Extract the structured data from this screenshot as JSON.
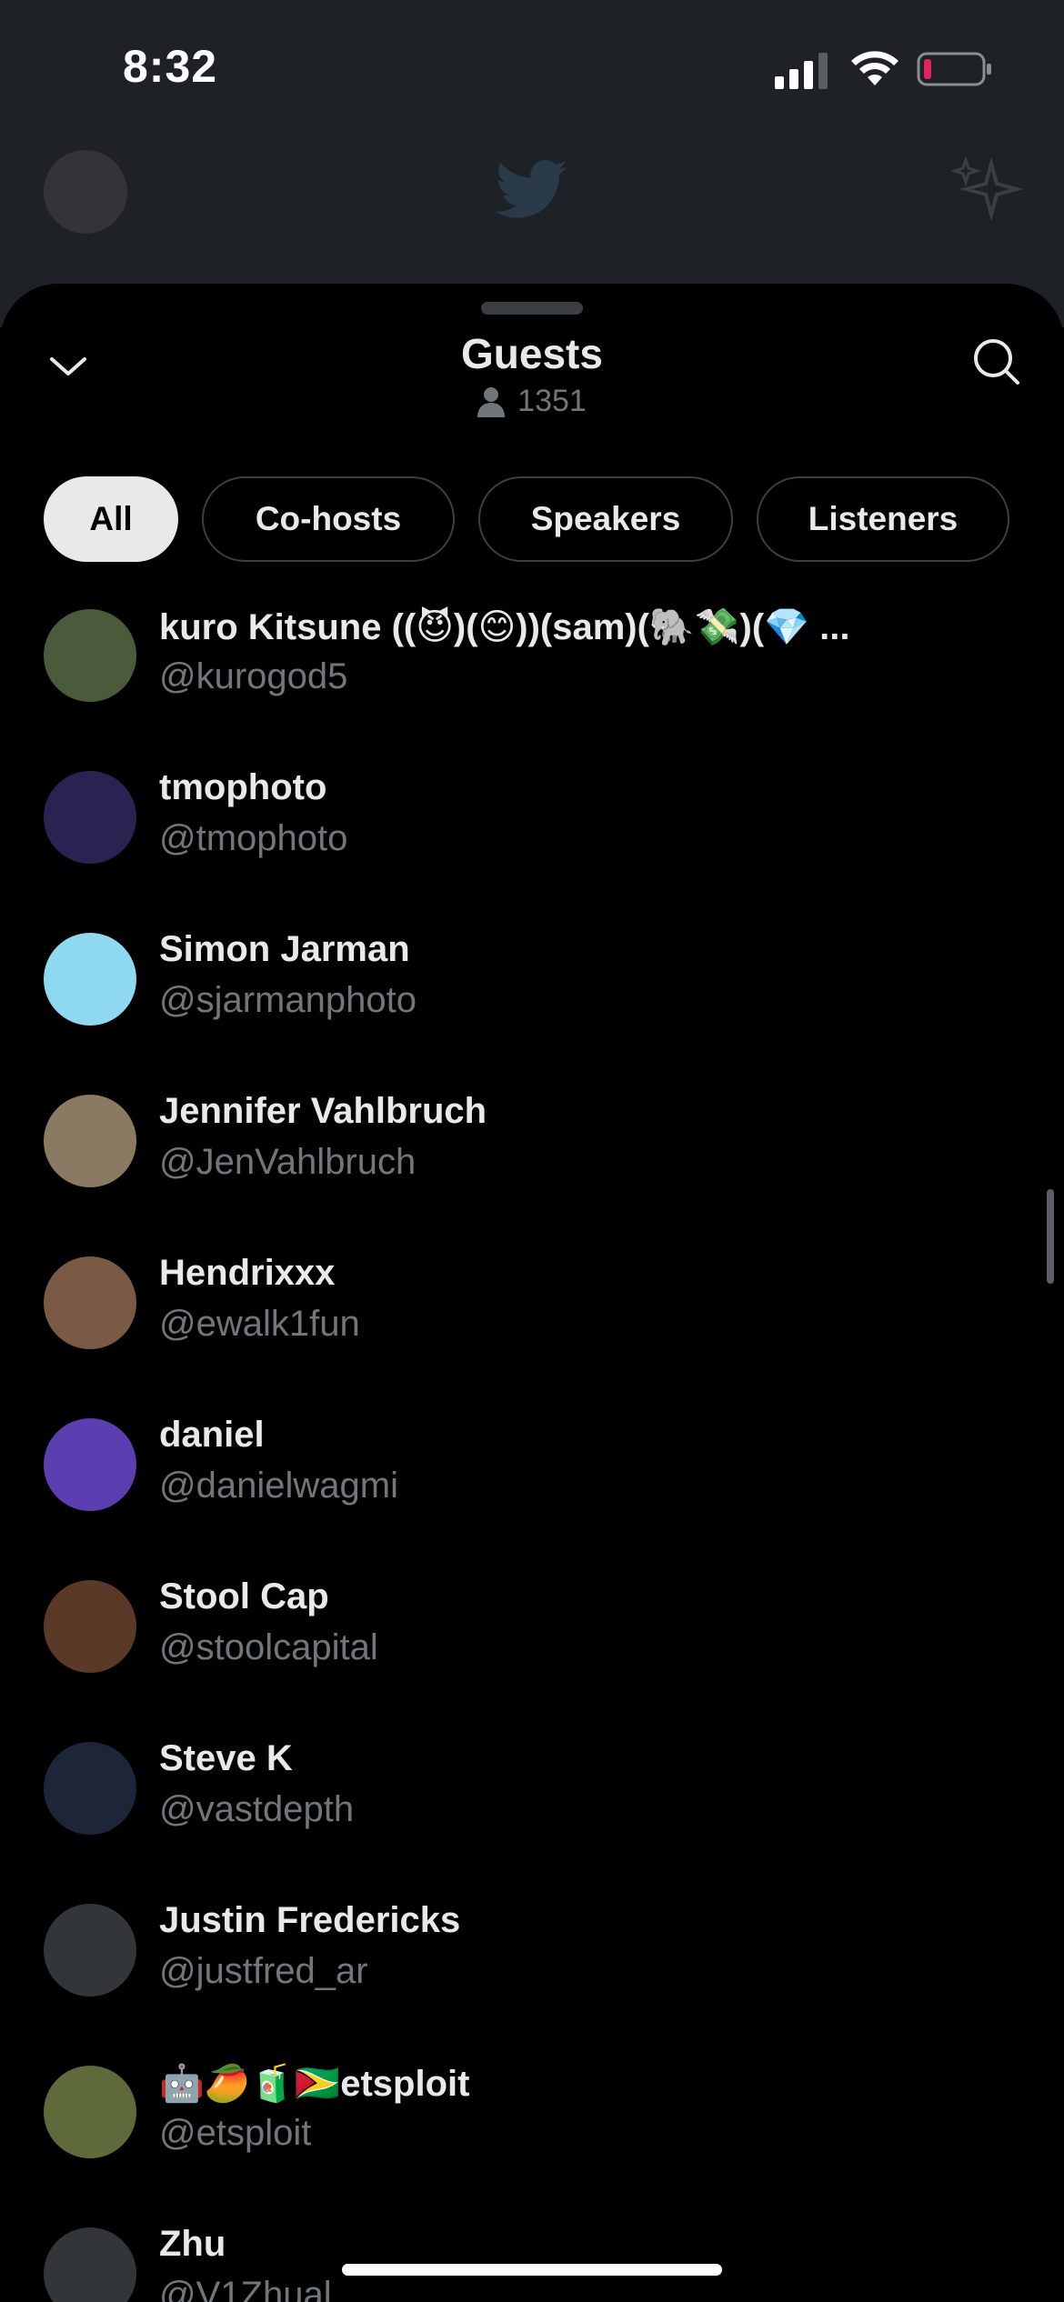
{
  "status": {
    "time": "8:32"
  },
  "sheet": {
    "title": "Guests",
    "listener_count": "1351"
  },
  "tabs": [
    {
      "label": "All",
      "active": true
    },
    {
      "label": "Co-hosts",
      "active": false
    },
    {
      "label": "Speakers",
      "active": false
    },
    {
      "label": "Listeners",
      "active": false
    }
  ],
  "guests": [
    {
      "name": "kuro Kitsune ((😈)(😊))(sam)(🐘💸)(💎 ...",
      "handle": "@kurogod5",
      "avatar_color": "#4a5a3a"
    },
    {
      "name": "tmophoto",
      "handle": "@tmophoto",
      "avatar_color": "#2a2352"
    },
    {
      "name": "Simon Jarman",
      "handle": "@sjarmanphoto",
      "avatar_color": "#8ed8f0"
    },
    {
      "name": "Jennifer Vahlbruch",
      "handle": "@JenVahlbruch",
      "avatar_color": "#8a7a62"
    },
    {
      "name": "Hendrixxx",
      "handle": "@ewalk1fun",
      "avatar_color": "#7a5a44"
    },
    {
      "name": "daniel",
      "handle": "@danielwagmi",
      "avatar_color": "#5b3fb0"
    },
    {
      "name": "Stool Cap",
      "handle": "@stoolcapital",
      "avatar_color": "#5a3a26"
    },
    {
      "name": "Steve K",
      "handle": "@vastdepth",
      "avatar_color": "#1c2638"
    },
    {
      "name": "Justin Fredericks",
      "handle": "@justfred_ar",
      "avatar_color": "#333639"
    },
    {
      "name": "🤖🥭🧃🇬🇾etsploit",
      "handle": "@etsploit",
      "avatar_color": "#5f6a3a"
    },
    {
      "name": "Zhu",
      "handle": "@V1Zhual",
      "avatar_color": "#333639"
    }
  ],
  "colors": {
    "accent_text": "#e7e9ea",
    "secondary_text": "#71767b",
    "battery_low": "#e0245e"
  },
  "icons": [
    "chevron-down-icon",
    "search-icon",
    "person-icon",
    "twitter-bird-icon",
    "sparkle-icon"
  ]
}
